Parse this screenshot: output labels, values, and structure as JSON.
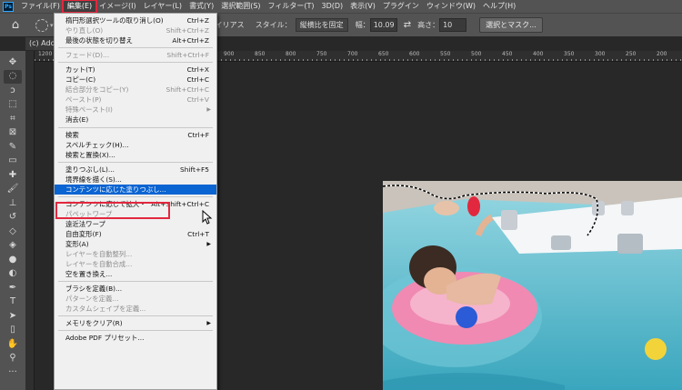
{
  "menubar": {
    "logo": "Ps",
    "items": [
      {
        "label": "ファイル(F)"
      },
      {
        "label": "編集(E)",
        "active": true
      },
      {
        "label": "イメージ(I)"
      },
      {
        "label": "レイヤー(L)"
      },
      {
        "label": "書式(Y)"
      },
      {
        "label": "選択範囲(S)"
      },
      {
        "label": "フィルター(T)"
      },
      {
        "label": "3D(D)"
      },
      {
        "label": "表示(V)"
      },
      {
        "label": "プラグイン"
      },
      {
        "label": "ウィンドウ(W)"
      },
      {
        "label": "ヘルプ(H)"
      }
    ]
  },
  "options": {
    "antialias": "アンチエイリアス",
    "style_label": "スタイル：",
    "style_value": "縦横比を固定",
    "width_label": "幅：",
    "width_value": "10.09",
    "height_label": "高さ：",
    "height_value": "10",
    "select_mask_button": "選択とマスク..."
  },
  "document": {
    "tab_label": "(c) Ado"
  },
  "ruler": {
    "labels": [
      "1200",
      "1150",
      "1100",
      "1050",
      "1000",
      "950",
      "900",
      "850",
      "800",
      "750",
      "700",
      "650",
      "600",
      "550",
      "500",
      "450",
      "400",
      "350",
      "300",
      "250",
      "200"
    ]
  },
  "tools": [
    {
      "name": "move-tool-icon",
      "glyph": "✥"
    },
    {
      "name": "elliptical-marquee-tool-icon",
      "glyph": "◌",
      "active": true
    },
    {
      "name": "lasso-tool-icon",
      "glyph": "ↄ"
    },
    {
      "name": "quick-select-tool-icon",
      "glyph": "⬚"
    },
    {
      "name": "crop-tool-icon",
      "glyph": "⌗"
    },
    {
      "name": "frame-tool-icon",
      "glyph": "⊠"
    },
    {
      "name": "eyedropper-tool-icon",
      "glyph": "✎"
    },
    {
      "name": "ruler-tool-icon",
      "glyph": "▭"
    },
    {
      "name": "healing-brush-tool-icon",
      "glyph": "✚"
    },
    {
      "name": "brush-tool-icon",
      "glyph": "🖌"
    },
    {
      "name": "clone-stamp-tool-icon",
      "glyph": "⊥"
    },
    {
      "name": "history-brush-tool-icon",
      "glyph": "↺"
    },
    {
      "name": "eraser-tool-icon",
      "glyph": "◇"
    },
    {
      "name": "paint-bucket-tool-icon",
      "glyph": "◈"
    },
    {
      "name": "blur-tool-icon",
      "glyph": "●"
    },
    {
      "name": "dodge-tool-icon",
      "glyph": "◐"
    },
    {
      "name": "pen-tool-icon",
      "glyph": "✒"
    },
    {
      "name": "type-tool-icon",
      "glyph": "T"
    },
    {
      "name": "path-select-tool-icon",
      "glyph": "➤"
    },
    {
      "name": "rectangle-tool-icon",
      "glyph": "▯"
    },
    {
      "name": "hand-tool-icon",
      "glyph": "✋"
    },
    {
      "name": "zoom-tool-icon",
      "glyph": "⚲"
    },
    {
      "name": "more-tools-icon",
      "glyph": "···"
    }
  ],
  "edit_menu": {
    "items": [
      {
        "label": "楕円形選択ツールの取り消し(O)",
        "shortcut": "Ctrl+Z"
      },
      {
        "label": "やり直し(O)",
        "shortcut": "Shift+Ctrl+Z",
        "disabled": true
      },
      {
        "label": "最後の状態を切り替え",
        "shortcut": "Alt+Ctrl+Z"
      },
      {
        "sep": true
      },
      {
        "label": "フェード(D)...",
        "shortcut": "Shift+Ctrl+F",
        "disabled": true
      },
      {
        "sep": true
      },
      {
        "label": "カット(T)",
        "shortcut": "Ctrl+X"
      },
      {
        "label": "コピー(C)",
        "shortcut": "Ctrl+C"
      },
      {
        "label": "結合部分をコピー(Y)",
        "shortcut": "Shift+Ctrl+C",
        "disabled": true
      },
      {
        "label": "ペースト(P)",
        "shortcut": "Ctrl+V",
        "disabled": true
      },
      {
        "label": "特殊ペースト(I)",
        "shortcut": "",
        "disabled": true,
        "submenu": true
      },
      {
        "label": "消去(E)",
        "shortcut": ""
      },
      {
        "sep": true
      },
      {
        "label": "検索",
        "shortcut": "Ctrl+F"
      },
      {
        "label": "スペルチェック(H)...",
        "shortcut": ""
      },
      {
        "label": "検索と置換(X)...",
        "shortcut": ""
      },
      {
        "sep": true
      },
      {
        "label": "塗りつぶし(L)...",
        "shortcut": "Shift+F5"
      },
      {
        "label": "境界線を描く(S)...",
        "shortcut": ""
      },
      {
        "label": "コンテンツに応じた塗りつぶし...",
        "shortcut": "",
        "highlight": true
      },
      {
        "sep": true
      },
      {
        "label": "コンテンツに応じて拡大・縮小",
        "shortcut": "Alt+Shift+Ctrl+C"
      },
      {
        "label": "パペットワープ",
        "shortcut": "",
        "disabled": true
      },
      {
        "label": "遠近法ワープ",
        "shortcut": ""
      },
      {
        "label": "自由変形(F)",
        "shortcut": "Ctrl+T"
      },
      {
        "label": "変形(A)",
        "shortcut": "",
        "submenu": true
      },
      {
        "label": "レイヤーを自動整列...",
        "shortcut": "",
        "disabled": true
      },
      {
        "label": "レイヤーを自動合成...",
        "shortcut": "",
        "disabled": true
      },
      {
        "label": "空を置き換え...",
        "shortcut": ""
      },
      {
        "sep": true
      },
      {
        "label": "ブラシを定義(B)...",
        "shortcut": ""
      },
      {
        "label": "パターンを定義...",
        "shortcut": "",
        "disabled": true
      },
      {
        "label": "カスタムシェイプを定義...",
        "shortcut": "",
        "disabled": true
      },
      {
        "sep": true
      },
      {
        "label": "メモリをクリア(R)",
        "shortcut": "",
        "submenu": true
      },
      {
        "sep": true
      },
      {
        "label": "Adobe PDF プリセット...",
        "shortcut": ""
      }
    ]
  },
  "colors": {
    "highlight": "#0a64d2",
    "annotation_red": "#e2283e",
    "ui_panel": "#535353",
    "canvas_bg": "#282828"
  }
}
